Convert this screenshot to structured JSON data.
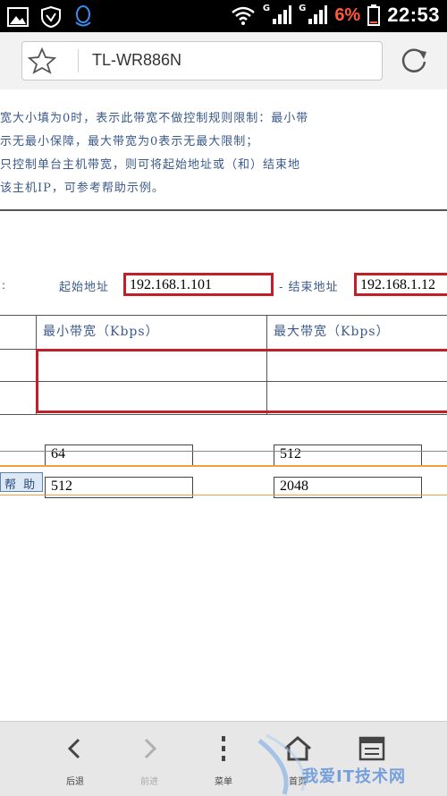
{
  "status_bar": {
    "network_tag_1": "G",
    "network_tag_2": "G",
    "battery_percent": "6%",
    "time": "22:53",
    "icons": [
      "gallery-icon",
      "shield-icon",
      "qq-icon",
      "wifi-icon",
      "signal-icon",
      "battery-icon"
    ]
  },
  "address_bar": {
    "title": "TL-WR886N",
    "icons": [
      "star-icon",
      "reload-icon"
    ]
  },
  "notes": [
    "宽大小填为0时，表示此带宽不做控制规则限制：最小带",
    "示无最小保障，最大带宽为0表示无最大限制；",
    "只控制单台主机带宽，则可将起始地址或（和）结束地",
    "该主机IP，可参考帮助示例。"
  ],
  "address_range": {
    "colon": ":",
    "start_label": "起始地址",
    "start_value": "192.168.1.101",
    "separator_label": "- 结束地址",
    "end_value": "192.168.1.12"
  },
  "bandwidth_table": {
    "min_header": "最小带宽（Kbps）",
    "max_header": "最大带宽（Kbps）",
    "rows": [
      {
        "min": "64",
        "max": "512"
      },
      {
        "min": "512",
        "max": "2048"
      }
    ]
  },
  "help_button": "帮 助",
  "bottom_nav": {
    "items": [
      {
        "label": "后退",
        "icon": "back-icon",
        "enabled": true
      },
      {
        "label": "前进",
        "icon": "forward-icon",
        "enabled": false
      },
      {
        "label": "菜单",
        "icon": "menu-icon",
        "enabled": true
      },
      {
        "label": "首页",
        "icon": "home-icon",
        "enabled": true
      },
      {
        "label": "",
        "icon": "tabs-icon",
        "enabled": true
      }
    ]
  },
  "watermark": "我爱IT技术网",
  "colors": {
    "highlight_red": "#c0202a",
    "label_blue": "#3a5a8a",
    "battery_red": "#ff5a3c",
    "divider_orange": "#f0a040"
  }
}
